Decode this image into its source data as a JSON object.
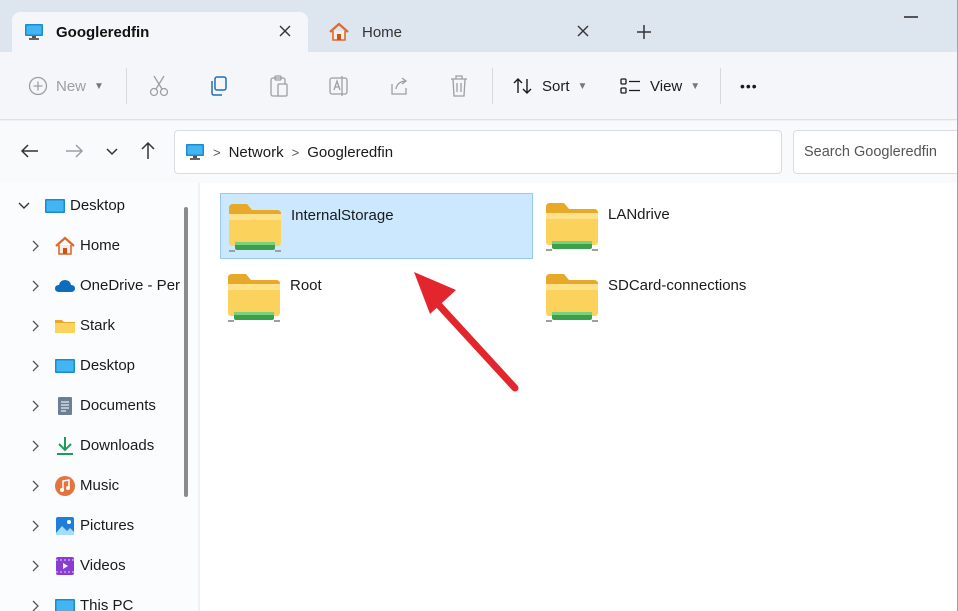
{
  "tabs": [
    {
      "label": "Googleredfin",
      "icon": "monitor-icon",
      "active": true
    },
    {
      "label": "Home",
      "icon": "home-icon",
      "active": false
    }
  ],
  "toolbar": {
    "new_label": "New",
    "sort_label": "Sort",
    "view_label": "View",
    "more_label": "•••"
  },
  "address": {
    "crumbs": [
      "Network",
      "Googleredfin"
    ]
  },
  "search": {
    "placeholder": "Search Googleredfin"
  },
  "sidebar": {
    "items": [
      {
        "label": "Desktop",
        "icon": "desktop-icon",
        "expanded": true
      },
      {
        "label": "Home",
        "icon": "home-icon"
      },
      {
        "label": "OneDrive - Per",
        "icon": "onedrive-cloud-icon"
      },
      {
        "label": "Stark",
        "icon": "folder-icon"
      },
      {
        "label": "Desktop",
        "icon": "desktop-icon"
      },
      {
        "label": "Documents",
        "icon": "documents-icon"
      },
      {
        "label": "Downloads",
        "icon": "downloads-icon"
      },
      {
        "label": "Music",
        "icon": "music-icon"
      },
      {
        "label": "Pictures",
        "icon": "pictures-icon"
      },
      {
        "label": "Videos",
        "icon": "videos-icon"
      },
      {
        "label": "This PC",
        "icon": "this-pc-icon"
      }
    ]
  },
  "folders": [
    {
      "label": "InternalStorage",
      "selected": true
    },
    {
      "label": "LANdrive",
      "selected": false
    },
    {
      "label": "Root",
      "selected": false
    },
    {
      "label": "SDCard-connections",
      "selected": false
    }
  ],
  "colors": {
    "accent": "#0067c0",
    "selection": "#cce8ff",
    "folder_yellow": "#f7c948",
    "arrow_red": "#e3262e"
  }
}
